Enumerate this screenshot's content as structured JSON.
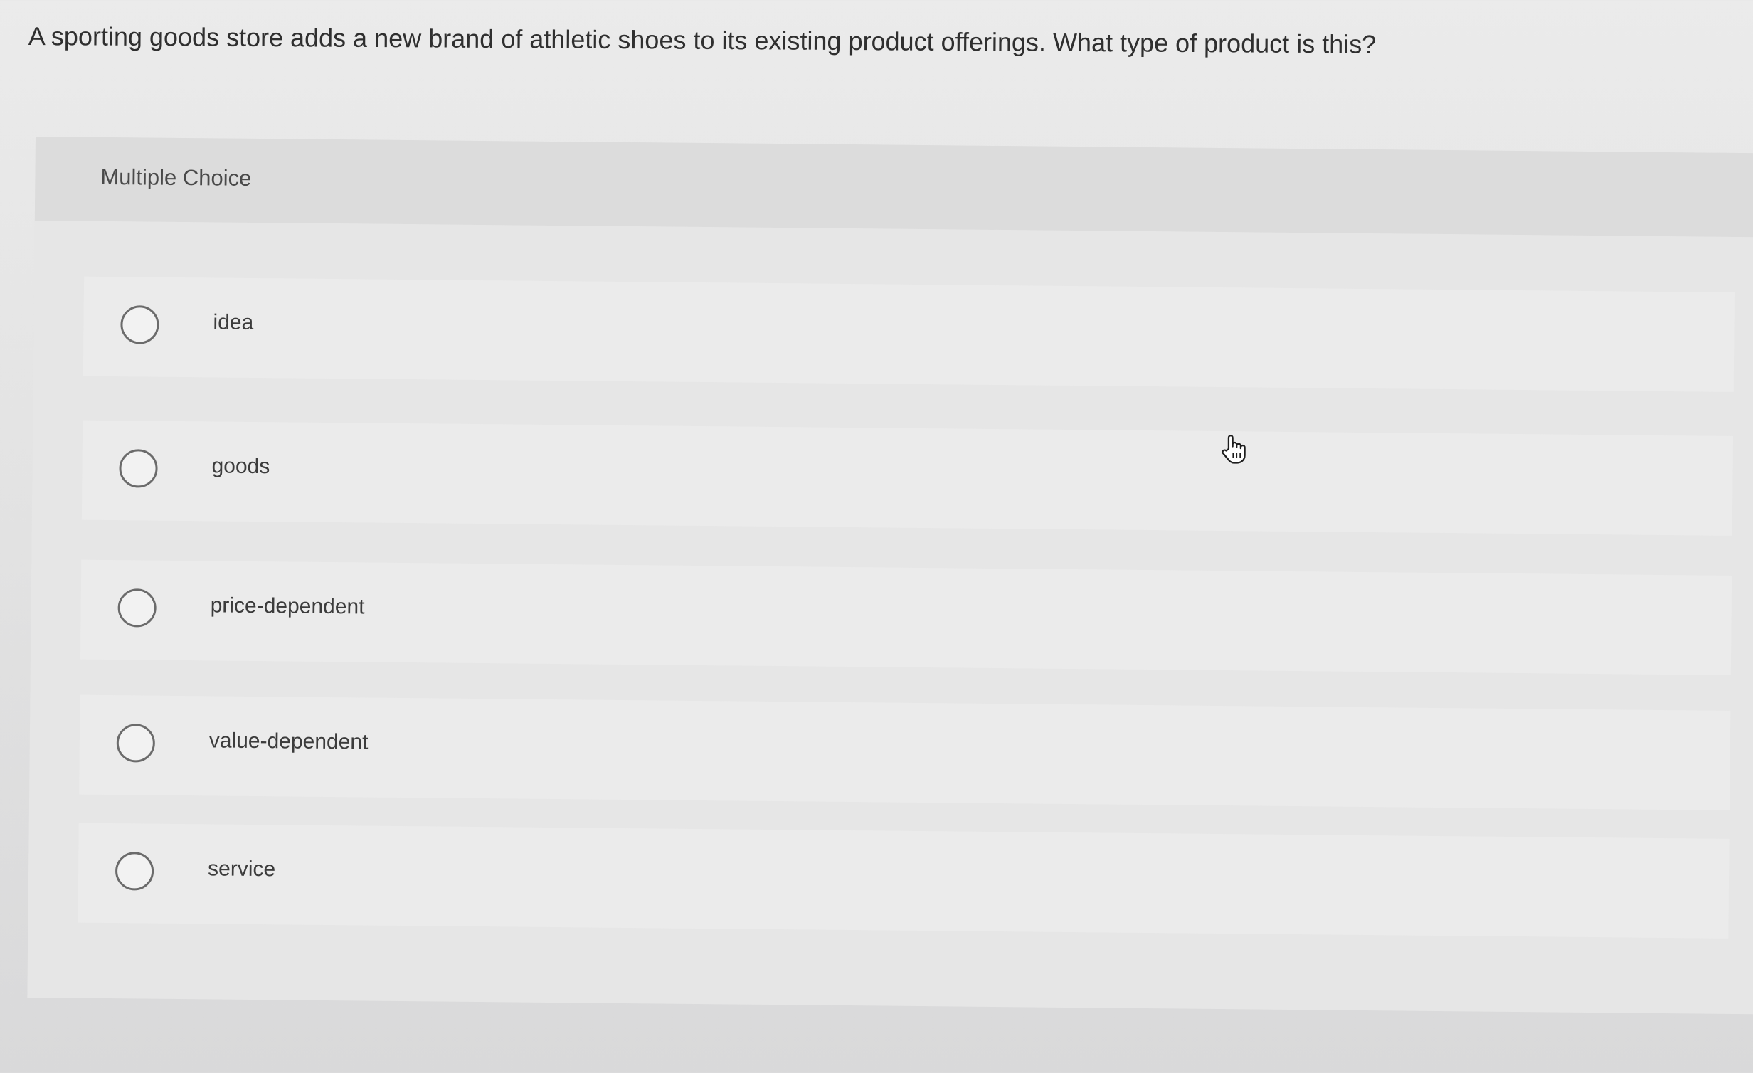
{
  "question": {
    "text": "A sporting goods store adds a new brand of athletic shoes to its existing product offerings. What type of product is this?"
  },
  "multiple_choice": {
    "label": "Multiple Choice",
    "options": [
      {
        "label": "idea"
      },
      {
        "label": "goods"
      },
      {
        "label": "price-dependent"
      },
      {
        "label": "value-dependent"
      },
      {
        "label": "service"
      }
    ]
  },
  "icons": {
    "radio": "radio-unselected-icon",
    "cursor": "hand-pointer-cursor-icon"
  },
  "colors": {
    "background": "#e3e3e3",
    "panel": "#e6e6e6",
    "radio_border": "#6b6b6b",
    "text": "#333333"
  }
}
